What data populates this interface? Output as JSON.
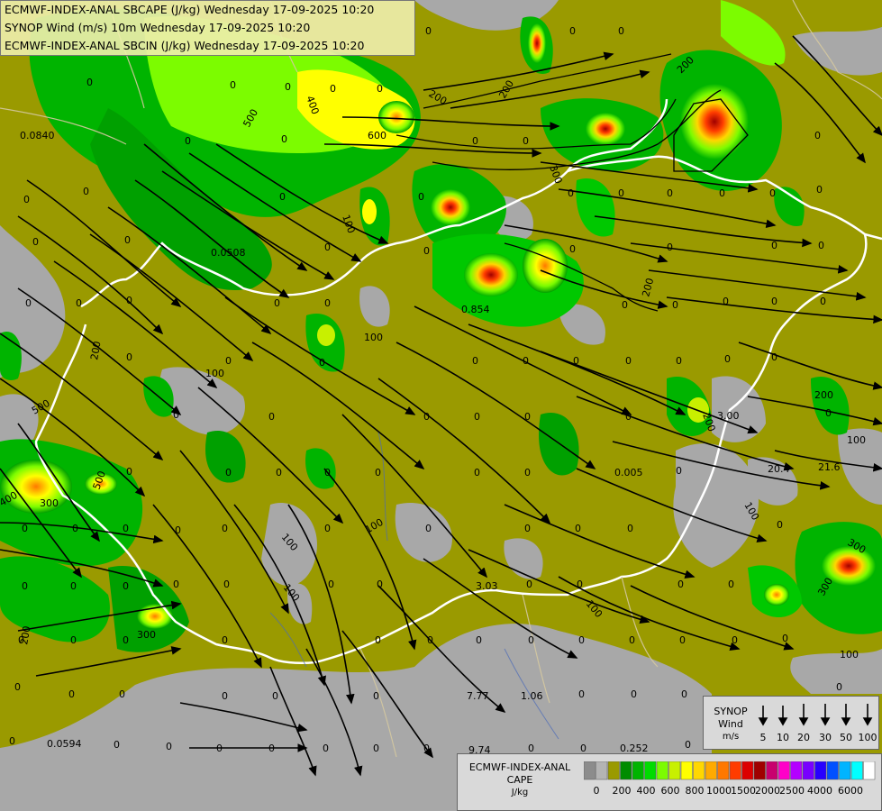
{
  "header": {
    "line1": "ECMWF-INDEX-ANAL SBCAPE (J/kg) Wednesday 17-09-2025 10:20",
    "line2": "SYNOP Wind (m/s) 10m Wednesday 17-09-2025 10:20",
    "line3": "ECMWF-INDEX-ANAL SBCIN (J/kg) Wednesday 17-09-2025 10:20"
  },
  "wind_legend": {
    "title": "SYNOP",
    "subtitle": "Wind",
    "unit": "m/s",
    "speeds": [
      "5",
      "10",
      "20",
      "30",
      "50",
      "100"
    ]
  },
  "cape_legend": {
    "title": "ECMWF-INDEX-ANAL",
    "subtitle": "CAPE",
    "unit": "J/kg",
    "ticks": [
      "0",
      "200",
      "400",
      "600",
      "800",
      "1000",
      "1500",
      "2000",
      "2500",
      "4000",
      "6000"
    ],
    "colors": [
      "#8c8c8c",
      "#b4b4b4",
      "#9a9a00",
      "#008c00",
      "#00b400",
      "#00dc00",
      "#7cfc00",
      "#c8f000",
      "#ffff00",
      "#ffd700",
      "#ffaa00",
      "#ff7800",
      "#ff3c00",
      "#dc0000",
      "#a00000",
      "#c8006e",
      "#ff00c8",
      "#b400ff",
      "#7800ff",
      "#2800ff",
      "#0050ff",
      "#00b4ff",
      "#00ffff",
      "#ffffff"
    ]
  },
  "map_labels": [
    "0.0840",
    "0.0508",
    "0.854",
    "0.005",
    "20.4",
    "21.6",
    "3.03",
    "7.77",
    "1.06",
    "9.74",
    "0.252",
    "0.0594",
    "3.00",
    "0",
    "100",
    "200",
    "300",
    "400",
    "500",
    "600"
  ],
  "colors": {
    "cape_zero": "#9a9a00",
    "cin_gray": "#a8a8a8",
    "border": "#ffffff",
    "streamline": "#000000"
  }
}
